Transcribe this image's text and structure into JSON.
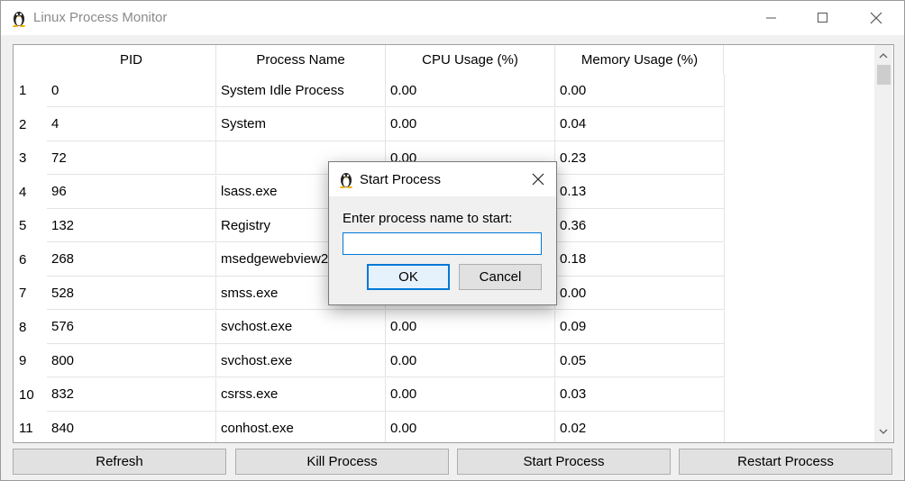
{
  "window": {
    "title": "Linux Process Monitor",
    "icon": "penguin-icon",
    "controls": [
      "minimize-icon",
      "maximize-icon",
      "close-icon"
    ]
  },
  "table": {
    "columns": [
      "PID",
      "Process Name",
      "CPU Usage (%)",
      "Memory Usage (%)"
    ],
    "rows": [
      {
        "num": "1",
        "pid": "0",
        "name": "System Idle Process",
        "cpu": "0.00",
        "mem": "0.00"
      },
      {
        "num": "2",
        "pid": "4",
        "name": "System",
        "cpu": "0.00",
        "mem": "0.04"
      },
      {
        "num": "3",
        "pid": "72",
        "name": "",
        "cpu": "0.00",
        "mem": "0.23"
      },
      {
        "num": "4",
        "pid": "96",
        "name": "lsass.exe",
        "cpu": "",
        "mem": "0.13"
      },
      {
        "num": "5",
        "pid": "132",
        "name": "Registry",
        "cpu": "",
        "mem": "0.36"
      },
      {
        "num": "6",
        "pid": "268",
        "name": "msedgewebview2.e",
        "cpu": "",
        "mem": "0.18"
      },
      {
        "num": "7",
        "pid": "528",
        "name": "smss.exe",
        "cpu": "",
        "mem": "0.00"
      },
      {
        "num": "8",
        "pid": "576",
        "name": "svchost.exe",
        "cpu": "0.00",
        "mem": "0.09"
      },
      {
        "num": "9",
        "pid": "800",
        "name": "svchost.exe",
        "cpu": "0.00",
        "mem": "0.05"
      },
      {
        "num": "10",
        "pid": "832",
        "name": "csrss.exe",
        "cpu": "0.00",
        "mem": "0.03"
      },
      {
        "num": "11",
        "pid": "840",
        "name": "conhost.exe",
        "cpu": "0.00",
        "mem": "0.02"
      }
    ]
  },
  "buttons": {
    "refresh": "Refresh",
    "kill": "Kill Process",
    "start": "Start Process",
    "restart": "Restart Process"
  },
  "dialog": {
    "title": "Start Process",
    "prompt": "Enter process name to start:",
    "input_value": "",
    "ok": "OK",
    "cancel": "Cancel"
  },
  "colors": {
    "accent": "#0078d7",
    "button_bg": "#e1e1e1",
    "window_bg": "#f0f0f0"
  }
}
